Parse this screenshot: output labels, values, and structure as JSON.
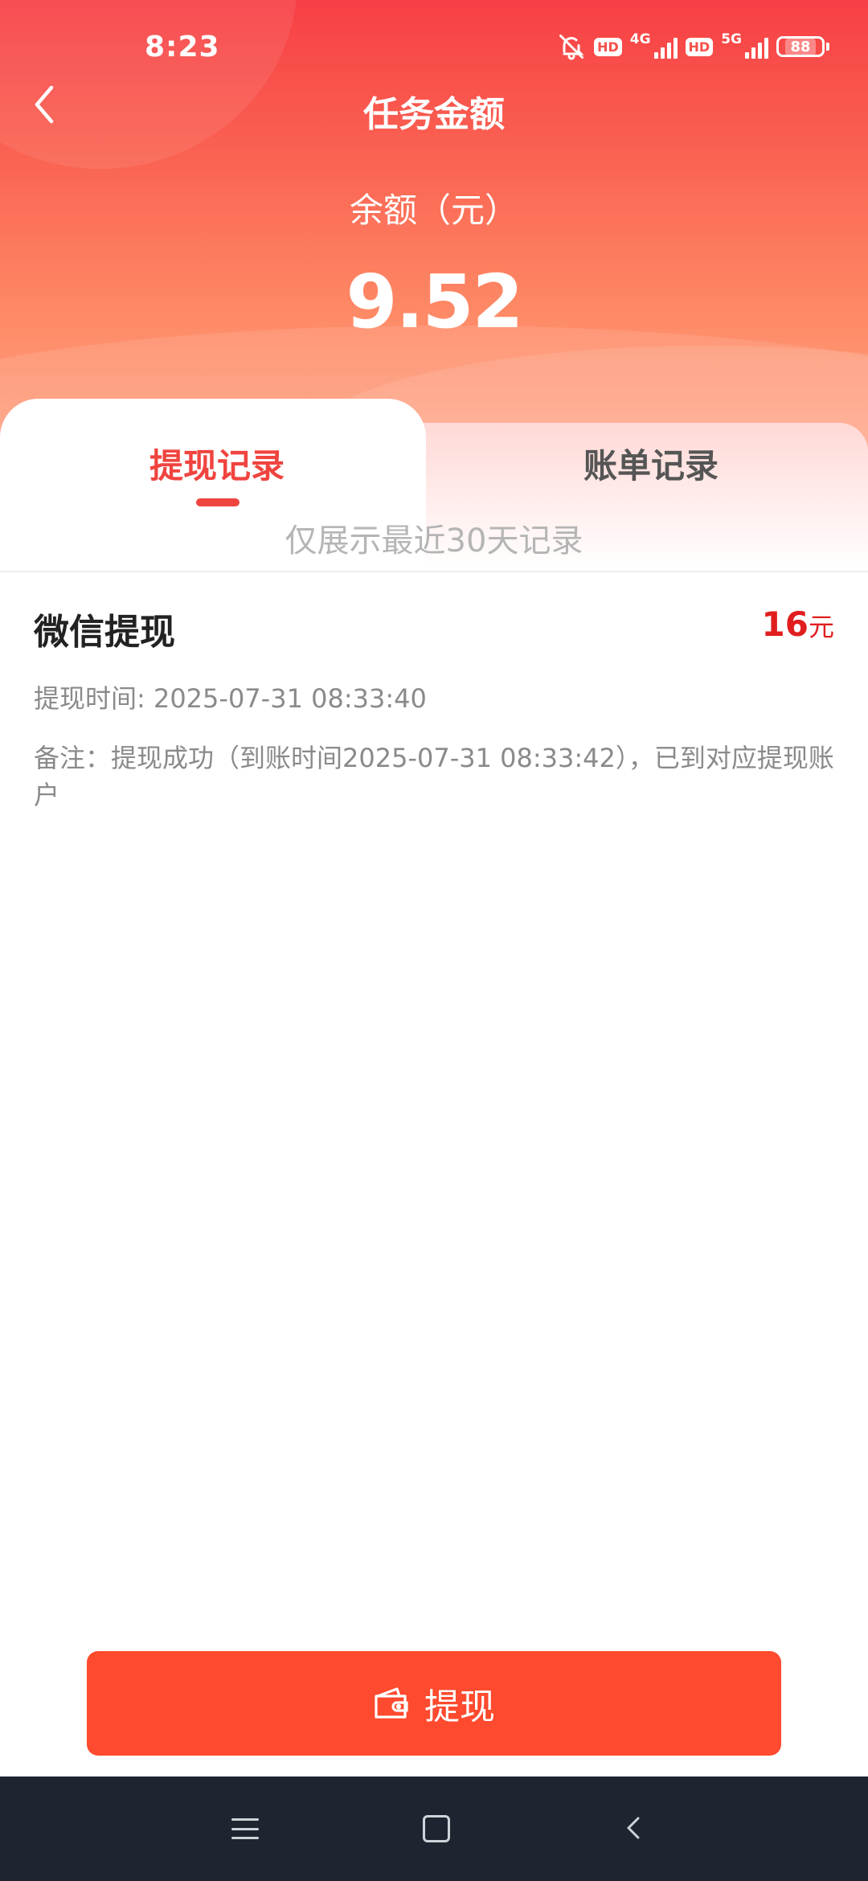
{
  "status_bar": {
    "time": "8:23",
    "hd1": "HD",
    "net1": "4G",
    "hd2": "HD",
    "net2": "5G",
    "battery": "88"
  },
  "header": {
    "title": "任务金额",
    "balance_label": "余额（元）",
    "balance_value": "9.52"
  },
  "tabs": [
    {
      "label": "提现记录",
      "active": true
    },
    {
      "label": "账单记录",
      "active": false
    }
  ],
  "notice": "仅展示最近30天记录",
  "records": [
    {
      "title": "微信提现",
      "amount": "16",
      "unit": "元",
      "time": "提现时间: 2025-07-31 08:33:40",
      "note": "备注：提现成功（到账时间2025-07-31 08:33:42），已到对应提现账户"
    }
  ],
  "withdraw_button": {
    "label": "提现"
  },
  "colors": {
    "accent": "#f0443f",
    "button": "#fe4a2e",
    "amount": "#e11e1e"
  }
}
